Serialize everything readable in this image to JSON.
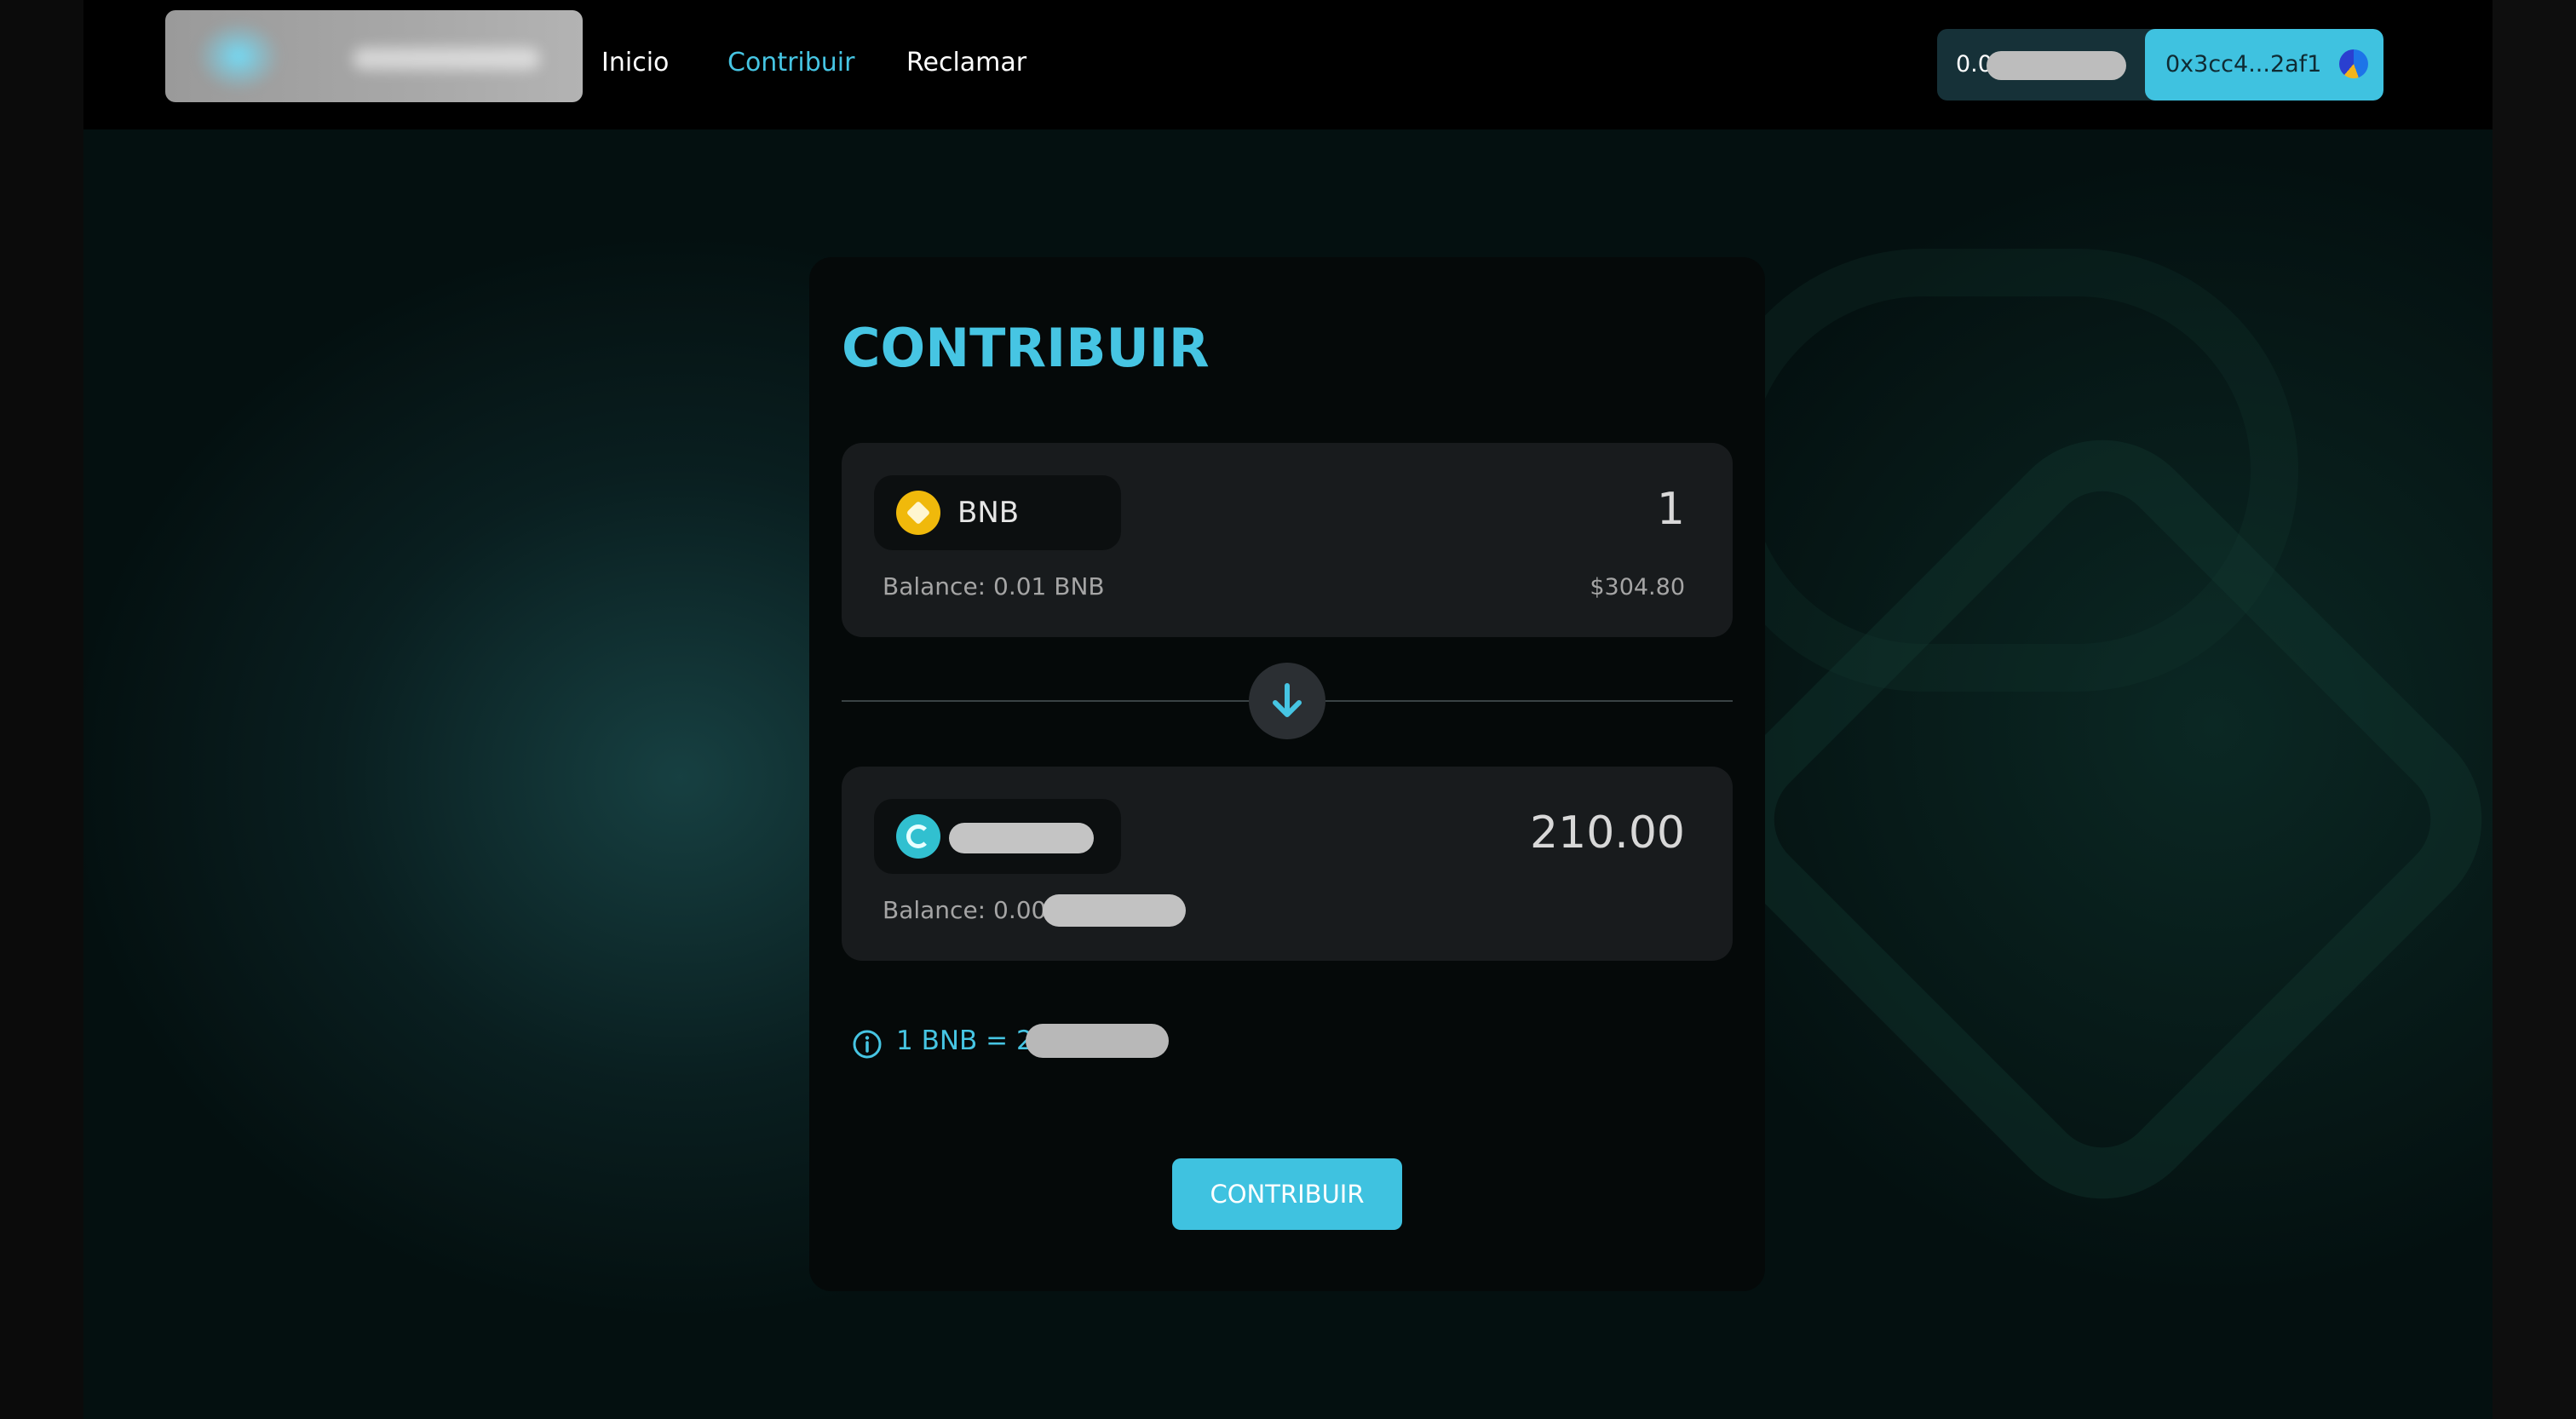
{
  "header": {
    "nav": [
      {
        "label": "Inicio"
      },
      {
        "label": "Contribuir",
        "active": true
      },
      {
        "label": "Reclamar"
      }
    ],
    "wallet": {
      "balance_prefix": "0.0",
      "address": "0x3cc4...2af1"
    }
  },
  "card": {
    "title": "CONTRIBUIR",
    "from": {
      "token": "BNB",
      "icon": "bnb-icon",
      "amount": "1",
      "balance": "Balance: 0.01 BNB",
      "usd_value": "$304.80"
    },
    "to": {
      "icon": "token-icon",
      "amount": "210.00",
      "balance": "Balance: 0.00"
    },
    "rate": "1 BNB = 210",
    "submit_label": "CONTRIBUIR"
  },
  "colors": {
    "accent": "#46c5e3",
    "button": "#3fc2e0",
    "card": "#050909",
    "box": "#181b1d"
  }
}
